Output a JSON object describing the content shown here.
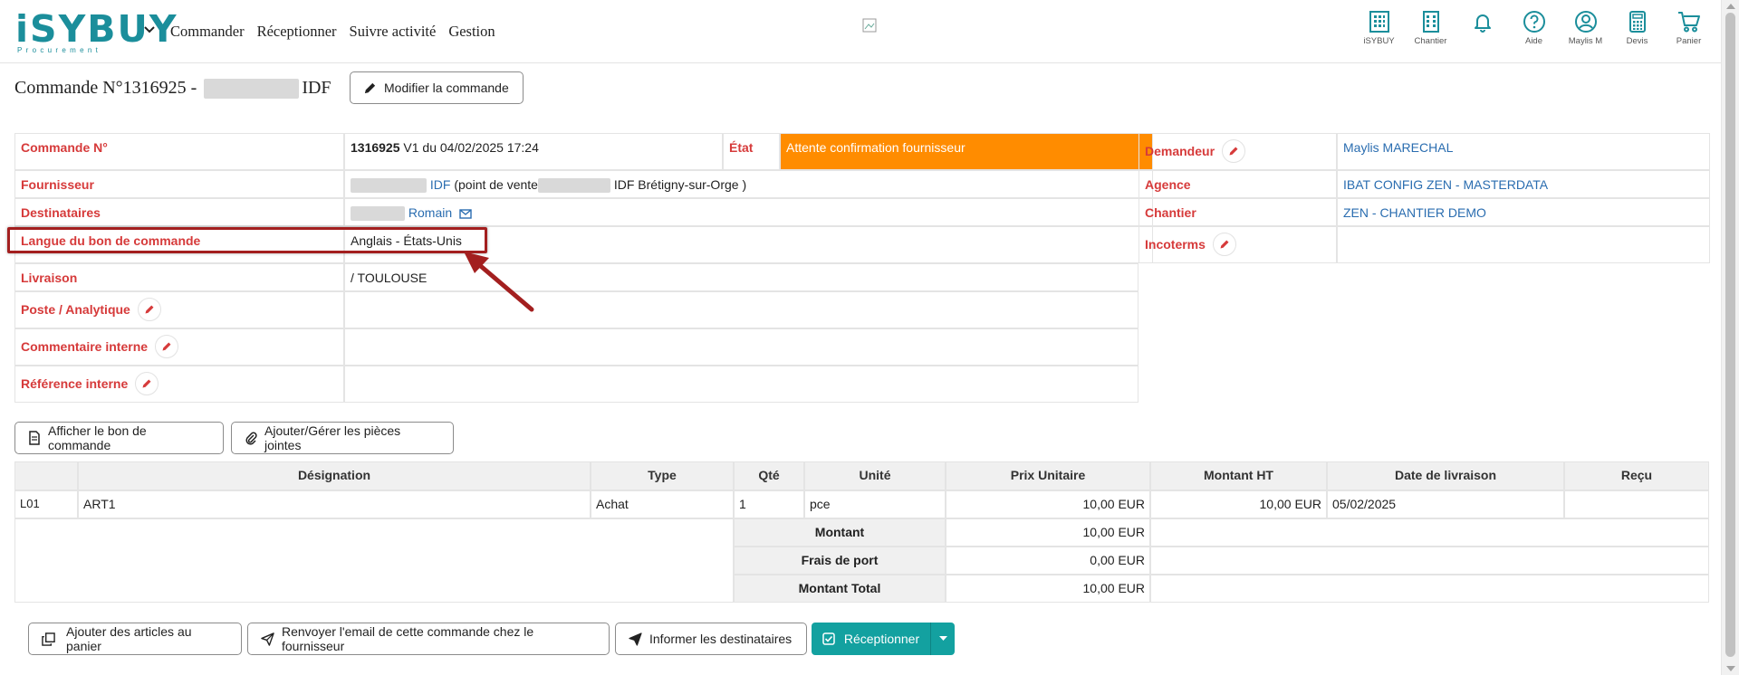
{
  "brand": {
    "logo_main": "iSYBUY",
    "logo_sub": "Procurement"
  },
  "nav": [
    "Commander",
    "Réceptionner",
    "Suivre activité",
    "Gestion"
  ],
  "top_icons": [
    {
      "name": "isybuy",
      "label": "iSYBUY",
      "icon": "building-icon"
    },
    {
      "name": "chantier",
      "label": "Chantier",
      "icon": "building-icon"
    },
    {
      "name": "notifications",
      "label": "",
      "icon": "bell-icon"
    },
    {
      "name": "aide",
      "label": "Aide",
      "icon": "help-icon"
    },
    {
      "name": "user",
      "label": "Maylis M",
      "icon": "user-icon"
    },
    {
      "name": "devis",
      "label": "Devis",
      "icon": "calculator-icon"
    },
    {
      "name": "panier",
      "label": "Panier",
      "icon": "cart-icon"
    }
  ],
  "header": {
    "title_prefix": "Commande N°1316925 -",
    "title_suffix": "IDF",
    "modify_button": "Modifier la commande"
  },
  "details": {
    "commande_label": "Commande N°",
    "commande_number": "1316925",
    "commande_rest": " V1 du 04/02/2025 17:24",
    "etat_label": "État",
    "etat_value": "Attente confirmation fournisseur",
    "demandeur_label": "Demandeur",
    "demandeur_value": "Maylis MARECHAL",
    "fournisseur_label": "Fournisseur",
    "fournisseur_link": "IDF",
    "fournisseur_mid": " (point de vente",
    "fournisseur_end": " IDF Brétigny-sur-Orge )",
    "agence_label": "Agence",
    "agence_value": "IBAT CONFIG ZEN - MASTERDATA",
    "destinataires_label": "Destinataires",
    "destinataires_value": "Romain",
    "chantier_label": "Chantier",
    "chantier_value": "ZEN - CHANTIER DEMO",
    "langue_label": "Langue du bon de commande",
    "langue_value": "Anglais - États-Unis",
    "incoterms_label": "Incoterms",
    "livraison_label": "Livraison",
    "livraison_value": "/ TOULOUSE",
    "poste_label": "Poste / Analytique",
    "commentaire_label": "Commentaire interne",
    "reference_label": "Référence interne"
  },
  "doc_buttons": {
    "afficher": "Afficher le bon de commande",
    "joindre": "Ajouter/Gérer les pièces jointes"
  },
  "items_table": {
    "headers": [
      "",
      "Désignation",
      "Type",
      "Qté",
      "Unité",
      "Prix Unitaire",
      "Montant HT",
      "Date de livraison",
      "Reçu"
    ],
    "rows": [
      [
        "L01",
        "ART1",
        "Achat",
        "1",
        "pce",
        "10,00 EUR",
        "10,00 EUR",
        "05/02/2025",
        ""
      ]
    ],
    "totals": [
      {
        "label": "Montant",
        "value": "10,00 EUR"
      },
      {
        "label": "Frais de port",
        "value": "0,00 EUR"
      },
      {
        "label": "Montant Total",
        "value": "10,00 EUR"
      }
    ]
  },
  "actions": {
    "add_to_cart": "Ajouter des articles au panier",
    "resend_email": "Renvoyer l'email de cette commande chez le fournisseur",
    "inform": "Informer les destinataires",
    "receive": "Réceptionner"
  },
  "colors": {
    "accent": "#13a1a0",
    "label_red": "#d63a3a",
    "state_orange": "#ff8c00",
    "link_blue": "#2a6db0",
    "annotation_red": "#a31f1f"
  }
}
